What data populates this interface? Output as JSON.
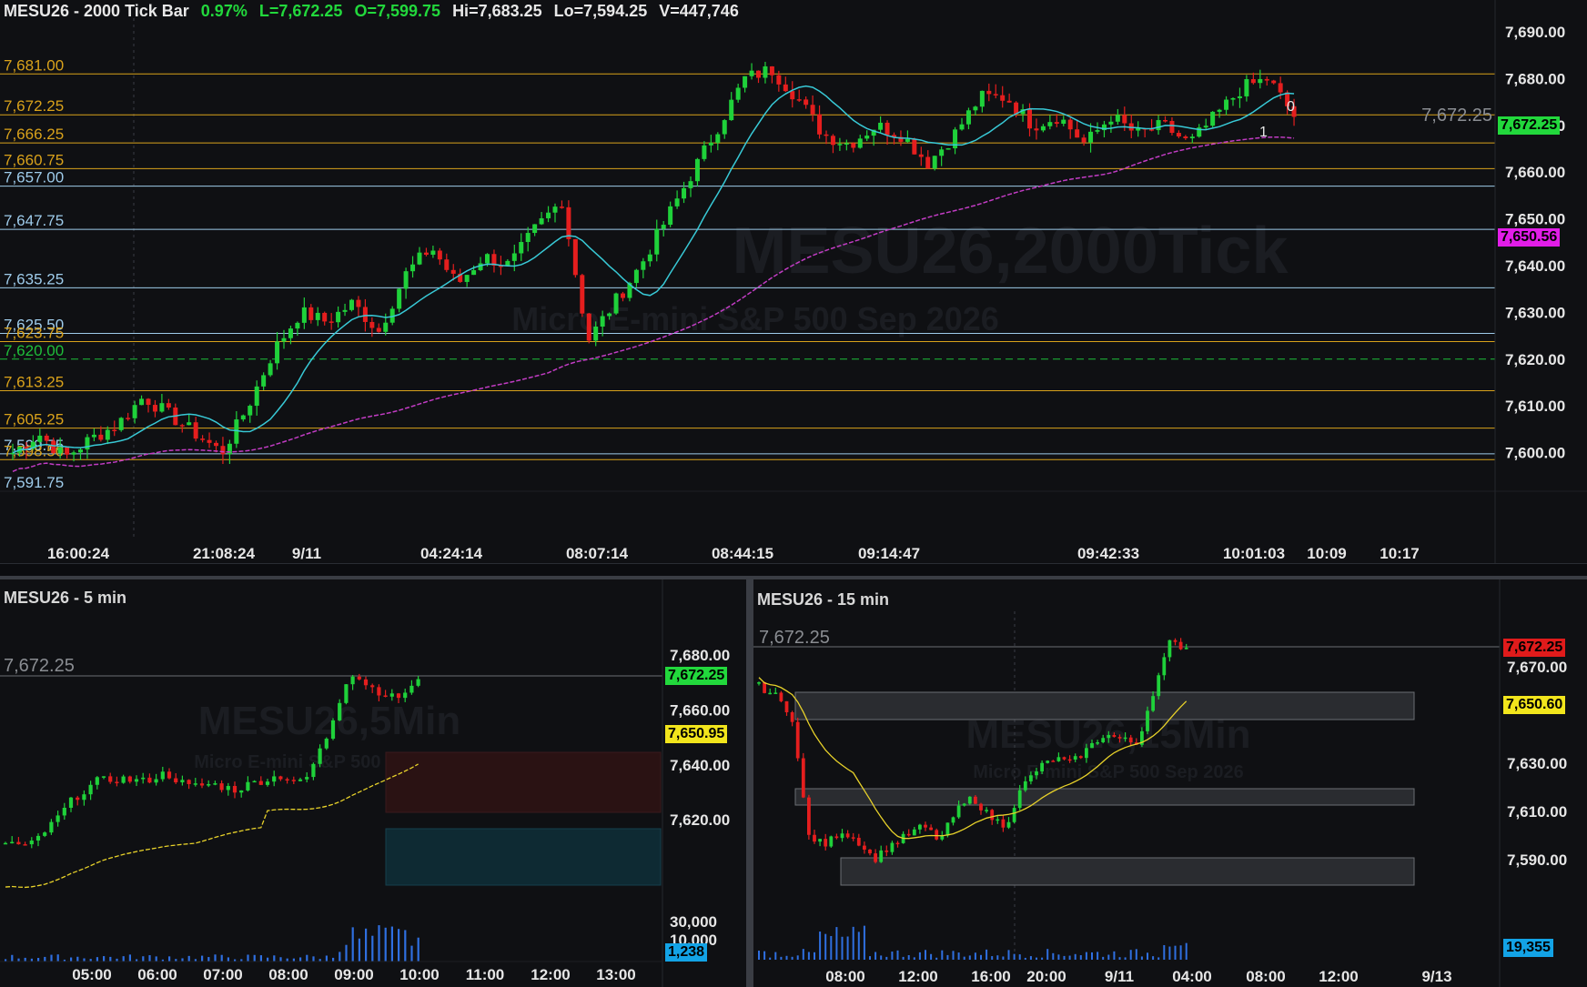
{
  "main_chart": {
    "symbol": "MESU26 - 2000 Tick Bar",
    "change_pct": "0.97%",
    "last": "L=7,672.25",
    "open": "O=7,599.75",
    "high": "Hi=7,683.25",
    "low": "Lo=7,594.25",
    "volume": "V=447,746",
    "watermark_title": "MESU26,2000Tick",
    "watermark_sub": "Micro E-mini S&P 500 Sep 2026",
    "y_axis": [
      "7,690.00",
      "7,680.00",
      "7,670.00",
      "7,660.00",
      "7,650.00",
      "7,640.00",
      "7,630.00",
      "7,620.00",
      "7,610.00",
      "7,600.00"
    ],
    "x_axis": [
      "16:00:24",
      "21:08:24",
      "9/11",
      "04:24:14",
      "08:07:14",
      "08:44:15",
      "09:14:47",
      "09:42:33",
      "10:01:03",
      "10:09",
      "10:17"
    ],
    "price_tag_last": "7,672.25",
    "price_tag_ma": "7,650.56",
    "last_price_text": "7,672.25",
    "marker_0": "0",
    "marker_1": "1",
    "levels": [
      {
        "label": "7,681.00",
        "color": "#d9a21b"
      },
      {
        "label": "7,672.25",
        "color": "#d9a21b"
      },
      {
        "label": "7,666.25",
        "color": "#d9a21b"
      },
      {
        "label": "7,660.75",
        "color": "#d9a21b"
      },
      {
        "label": "7,657.00",
        "color": "#9ecbea"
      },
      {
        "label": "7,647.75",
        "color": "#9ecbea"
      },
      {
        "label": "7,635.25",
        "color": "#9ecbea"
      },
      {
        "label": "7,625.50",
        "color": "#9ecbea"
      },
      {
        "label": "7,623.75",
        "color": "#d9a21b"
      },
      {
        "label": "7,620.00",
        "color": "#1fbf3a"
      },
      {
        "label": "7,613.25",
        "color": "#d9a21b"
      },
      {
        "label": "7,605.25",
        "color": "#d9a21b"
      },
      {
        "label": "7,599.75",
        "color": "#9ecbea"
      },
      {
        "label": "7,598.50",
        "color": "#d9a21b"
      },
      {
        "label": "7,591.75",
        "color": "#9ecbea"
      }
    ]
  },
  "chart_5min": {
    "title": "MESU26 - 5 min",
    "watermark_title": "MESU26,5Min",
    "watermark_sub": "Micro E-mini S&P 500 Sep 2026",
    "last_price_text": "7,672.25",
    "y_axis": [
      "7,680.00",
      "7,660.00",
      "7,640.00",
      "7,620.00"
    ],
    "vol_axis": [
      "30,000",
      "10,000"
    ],
    "x_axis": [
      "05:00",
      "06:00",
      "07:00",
      "08:00",
      "09:00",
      "10:00",
      "11:00",
      "12:00",
      "13:00"
    ],
    "tag_last": "7,672.25",
    "tag_ma": "7,650.95",
    "tag_vol": "1,238"
  },
  "chart_15min": {
    "title": "MESU26 - 15 min",
    "watermark_title": "MESU26,15Min",
    "watermark_sub": "Micro E-mini S&P 500 Sep 2026",
    "last_price_text": "7,672.25",
    "y_axis": [
      "7,670.00",
      "7,630.00",
      "7,610.00",
      "7,590.00"
    ],
    "x_axis": [
      "08:00",
      "12:00",
      "16:00",
      "20:00",
      "9/11",
      "04:00",
      "08:00",
      "12:00",
      "9/13"
    ],
    "tag_last": "7,672.25",
    "tag_ma": "7,650.60",
    "tag_vol": "19,355"
  },
  "colors": {
    "up": "#1fd13a",
    "down": "#e51e1e",
    "ma_fast": "#38c9d6",
    "ma_slow": "#c23cc4",
    "ma_yellow": "#e8d22a",
    "tag_green": "#22d83c",
    "tag_magenta": "#e21de8",
    "tag_yellow": "#f2e51c",
    "tag_red": "#e01b1b",
    "tag_blue": "#13a3e6"
  }
}
